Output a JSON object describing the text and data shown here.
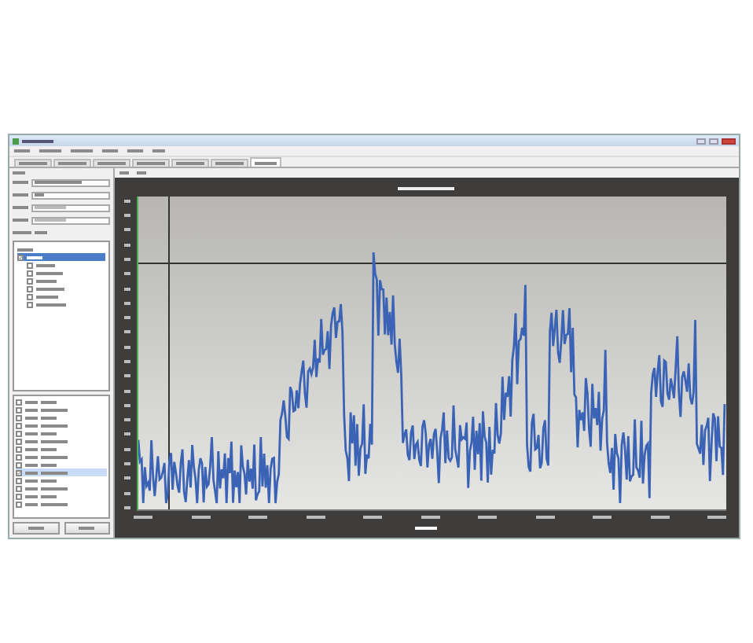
{
  "tabs": [
    {
      "selected": false
    },
    {
      "selected": false
    },
    {
      "selected": false
    },
    {
      "selected": false
    },
    {
      "selected": false
    },
    {
      "selected": false
    },
    {
      "selected": true
    }
  ],
  "tree": {
    "checked": true,
    "selected": true,
    "children": [
      {
        "checked": false
      },
      {
        "checked": false
      },
      {
        "checked": false
      },
      {
        "checked": false
      },
      {
        "checked": false
      },
      {
        "checked": false
      }
    ]
  },
  "list": [
    {
      "checked": false,
      "selected": false
    },
    {
      "checked": false,
      "selected": false
    },
    {
      "checked": false,
      "selected": false
    },
    {
      "checked": false,
      "selected": false
    },
    {
      "checked": false,
      "selected": false
    },
    {
      "checked": false,
      "selected": false
    },
    {
      "checked": false,
      "selected": false
    },
    {
      "checked": false,
      "selected": false
    },
    {
      "checked": false,
      "selected": false
    },
    {
      "checked": true,
      "selected": true
    },
    {
      "checked": false,
      "selected": false
    },
    {
      "checked": false,
      "selected": false
    },
    {
      "checked": false,
      "selected": false
    },
    {
      "checked": false,
      "selected": false
    }
  ]
}
